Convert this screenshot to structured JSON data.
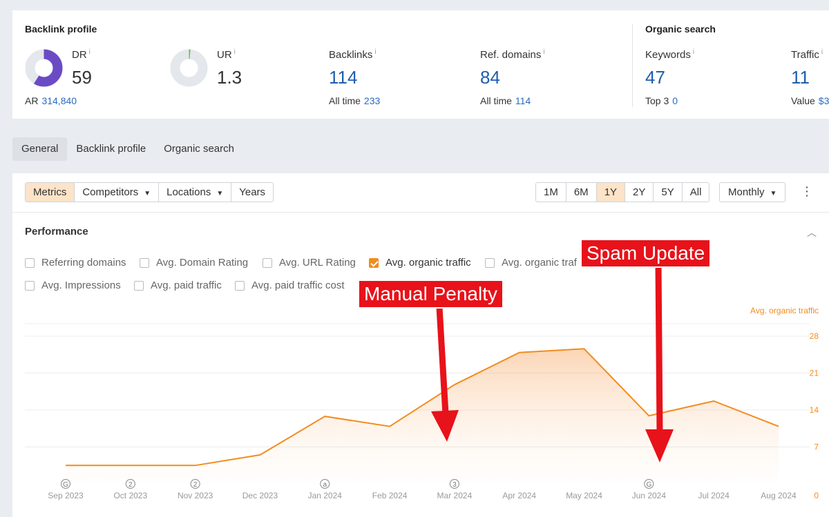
{
  "backlink_profile": {
    "title": "Backlink profile",
    "dr": {
      "label": "DR",
      "info": "i",
      "value": "59",
      "fraction": 0.59
    },
    "ar": {
      "label": "AR",
      "value": "314,840"
    },
    "ur": {
      "label": "UR",
      "info": "i",
      "value": "1.3",
      "fraction": 0.013
    },
    "backlinks": {
      "label": "Backlinks",
      "info": "i",
      "value": "114",
      "sub_label": "All time",
      "sub_value": "233"
    },
    "ref_domains": {
      "label": "Ref. domains",
      "info": "i",
      "value": "84",
      "sub_label": "All time",
      "sub_value": "114"
    }
  },
  "organic_search": {
    "title": "Organic search",
    "keywords": {
      "label": "Keywords",
      "info": "i",
      "value": "47",
      "sub_label": "Top 3",
      "sub_value": "0"
    },
    "traffic": {
      "label": "Traffic",
      "info": "i",
      "value": "11",
      "sub_label": "Value",
      "sub_value": "$3"
    }
  },
  "tabs": [
    "General",
    "Backlink profile",
    "Organic search"
  ],
  "toolbar": {
    "left": [
      "Metrics",
      "Competitors",
      "Locations",
      "Years"
    ],
    "ranges": [
      "1M",
      "6M",
      "1Y",
      "2Y",
      "5Y",
      "All"
    ],
    "interval": "Monthly"
  },
  "performance": {
    "title": "Performance",
    "checkboxes": [
      {
        "label": "Referring domains",
        "checked": false
      },
      {
        "label": "Avg. Domain Rating",
        "checked": false
      },
      {
        "label": "Avg. URL Rating",
        "checked": false
      },
      {
        "label": "Avg. organic traffic",
        "checked": true
      },
      {
        "label": "Avg. organic traf",
        "checked": false
      },
      {
        "label": "Avg. Impressions",
        "checked": false
      },
      {
        "label": "Avg. paid traffic",
        "checked": false
      },
      {
        "label": "Avg. paid traffic cost",
        "checked": false
      }
    ]
  },
  "callouts": {
    "manual": "Manual Penalty",
    "spam": "Spam Update"
  },
  "colors": {
    "accent": "#f28c1e",
    "dr": "#6b4bc4",
    "ur": "#6fbf3f",
    "link": "#1f5dae",
    "callout": "#e8121a"
  },
  "chart_data": {
    "type": "area",
    "ylabel": "Avg. organic traffic",
    "categories": [
      "Sep 2023",
      "Oct 2023",
      "Nov 2023",
      "Dec 2023",
      "Jan 2024",
      "Feb 2024",
      "Mar 2024",
      "Apr 2024",
      "May 2024",
      "Jun 2024",
      "Jul 2024",
      "Aug 2024"
    ],
    "values": [
      3.5,
      3.5,
      3.5,
      5.5,
      12.8,
      10.9,
      18.8,
      24.9,
      25.6,
      12.9,
      15.7,
      10.9
    ],
    "yticks": [
      "0",
      "7",
      "14",
      "21",
      "28"
    ],
    "ylim": [
      0,
      28
    ],
    "grid": true,
    "legend": "top-right",
    "annotations": [
      "G",
      "2",
      "2",
      "",
      "a",
      "",
      "3",
      "",
      "",
      "G",
      "",
      ""
    ]
  }
}
